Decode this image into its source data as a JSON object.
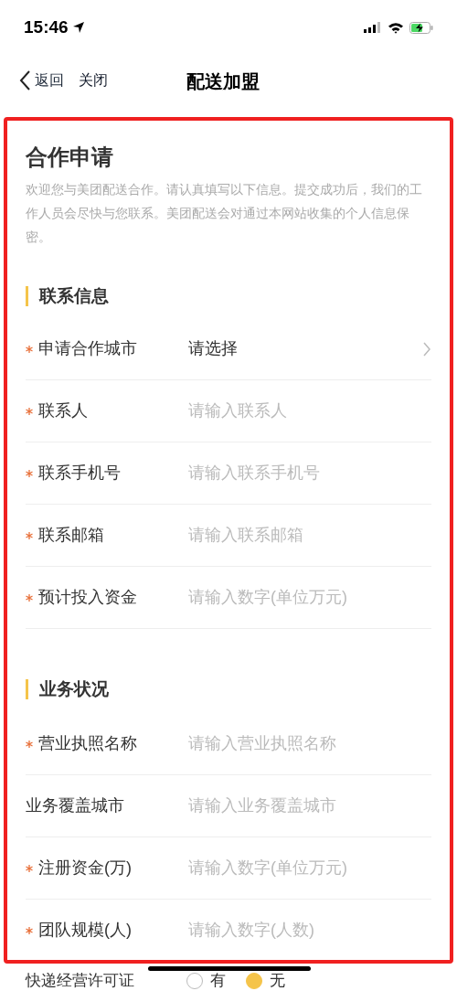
{
  "status_bar": {
    "time": "15:46"
  },
  "nav": {
    "back": "返回",
    "close": "关闭",
    "title": "配送加盟"
  },
  "form": {
    "title": "合作申请",
    "description": "欢迎您与美团配送合作。请认真填写以下信息。提交成功后，我们的工作人员会尽快与您联系。美团配送会对通过本网站收集的个人信息保密。",
    "sections": [
      {
        "title": "联系信息",
        "fields": [
          {
            "kind": "select",
            "label": "申请合作城市",
            "required": true,
            "value": "请选择"
          },
          {
            "kind": "input",
            "label": "联系人",
            "required": true,
            "placeholder": "请输入联系人"
          },
          {
            "kind": "input",
            "label": "联系手机号",
            "required": true,
            "placeholder": "请输入联系手机号"
          },
          {
            "kind": "input",
            "label": "联系邮箱",
            "required": true,
            "placeholder": "请输入联系邮箱"
          },
          {
            "kind": "input",
            "label": "预计投入资金",
            "required": true,
            "placeholder": "请输入数字(单位万元)"
          }
        ]
      },
      {
        "title": "业务状况",
        "fields": [
          {
            "kind": "input",
            "label": "营业执照名称",
            "required": true,
            "placeholder": "请输入营业执照名称"
          },
          {
            "kind": "input",
            "label": "业务覆盖城市",
            "required": false,
            "placeholder": "请输入业务覆盖城市"
          },
          {
            "kind": "input",
            "label": "注册资金(万)",
            "required": true,
            "placeholder": "请输入数字(单位万元)"
          },
          {
            "kind": "input",
            "label": "团队规模(人)",
            "required": true,
            "placeholder": "请输入数字(人数)"
          }
        ]
      }
    ]
  },
  "license": {
    "label": "快递经营许可证",
    "options": [
      {
        "label": "有",
        "selected": false
      },
      {
        "label": "无",
        "selected": true
      }
    ]
  }
}
